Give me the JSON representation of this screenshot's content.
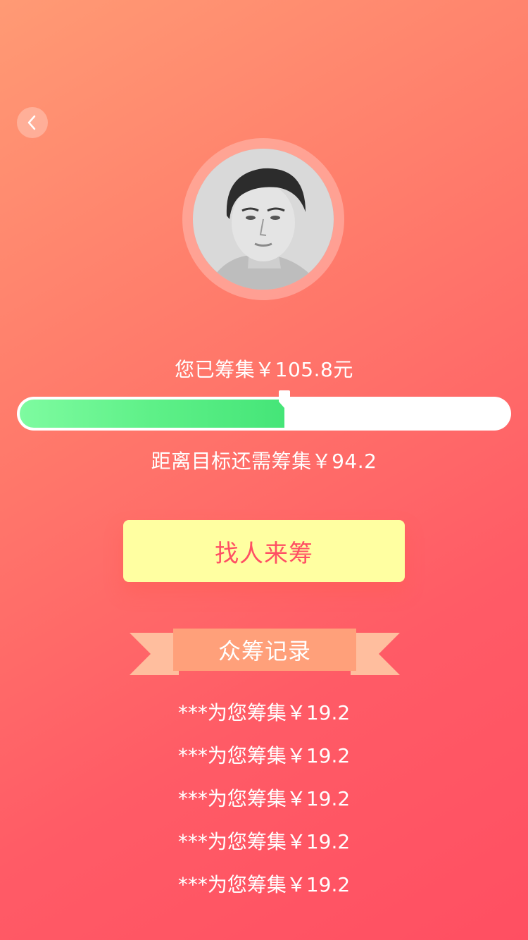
{
  "header": {
    "back_icon": "chevron-left-icon"
  },
  "profile": {
    "avatar_icon": "user-photo"
  },
  "progress": {
    "raised_text": "您已筹集￥105.8元",
    "fraction": 0.5414,
    "remaining_text": "距离目标还需筹集￥94.2"
  },
  "action": {
    "button_label": "找人来筹"
  },
  "records": {
    "title": "众筹记录",
    "items": [
      "***为您筹集￥19.2",
      "***为您筹集￥19.2",
      "***为您筹集￥19.2",
      "***为您筹集￥19.2",
      "***为您筹集￥19.2"
    ]
  },
  "colors": {
    "accent_red": "#ff4f64",
    "button_yellow": "#ffffa1",
    "progress_green": "#5ef088",
    "ribbon_orange": "#ffa07a"
  }
}
